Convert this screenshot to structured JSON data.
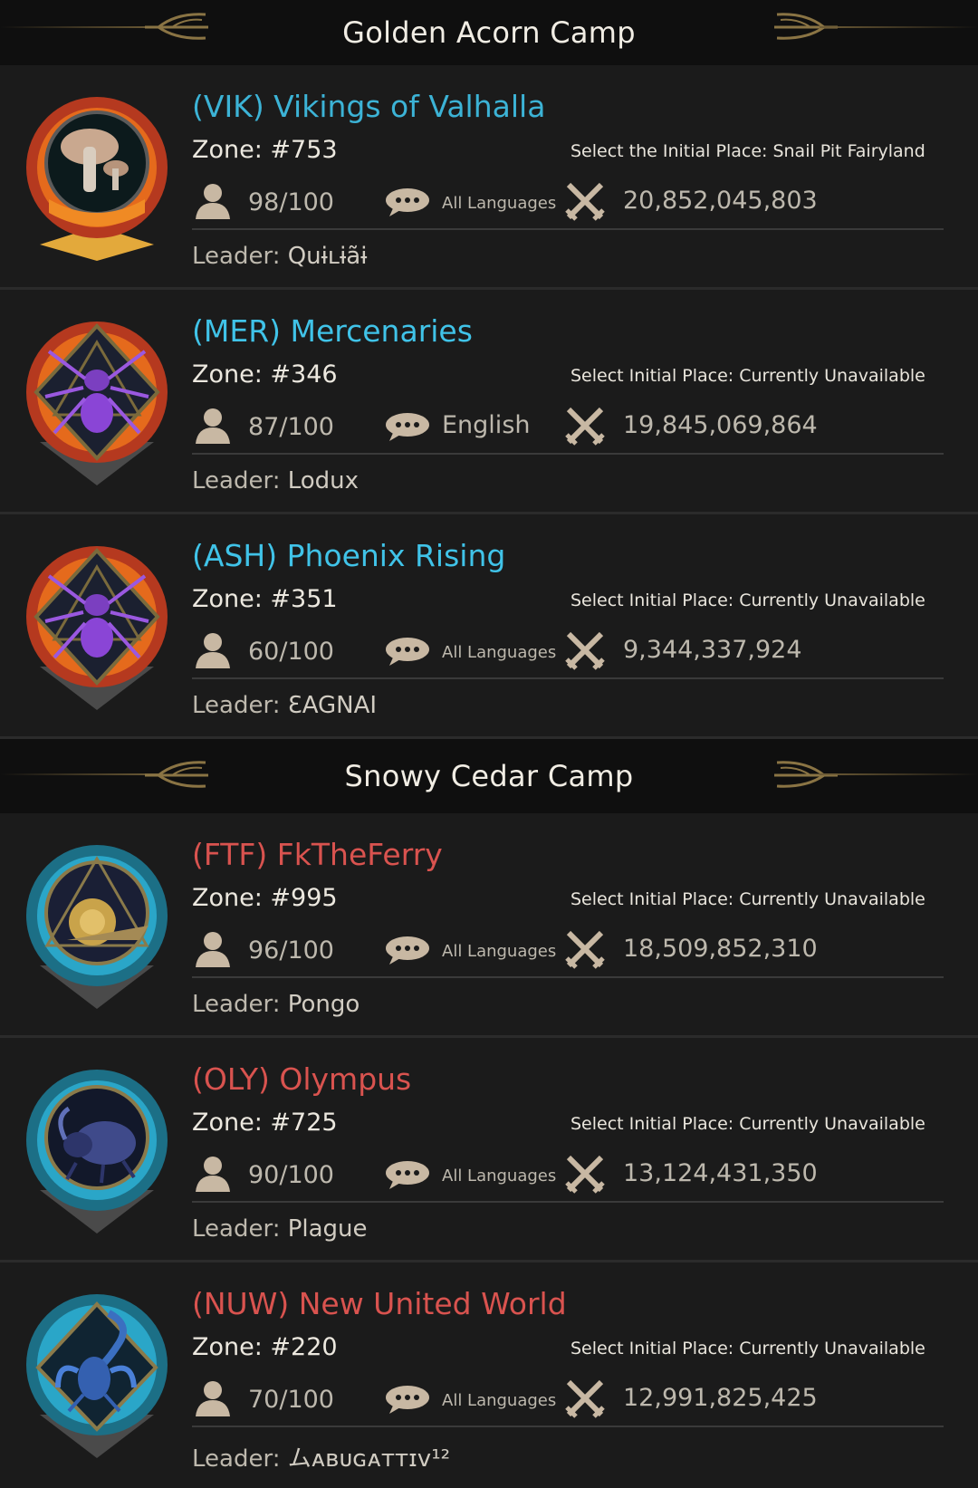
{
  "camps": [
    {
      "title": "Golden Acorn Camp",
      "alliances": [
        {
          "name": "(VIK) Vikings of Valhalla",
          "zone": "Zone: #753",
          "initial_place": "Select the Initial Place: Snail Pit Fairyland",
          "members": "98/100",
          "language": "All Languages",
          "power": "20,852,045,803",
          "leader_label": "Leader: ",
          "leader": "Quɨʟɨãɨ",
          "emblem_icon": "mushroom-emblem-icon"
        },
        {
          "name": "(MER) Mercenaries",
          "zone": "Zone: #346",
          "initial_place": "Select Initial Place: Currently Unavailable",
          "members": "87/100",
          "language": "English",
          "power": "19,845,069,864",
          "leader_label": "Leader: ",
          "leader": "Lodux",
          "emblem_icon": "spider-emblem-icon"
        },
        {
          "name": "(ASH) Phoenix Rising",
          "zone": "Zone: #351",
          "initial_place": "Select Initial Place: Currently Unavailable",
          "members": "60/100",
          "language": "All Languages",
          "power": "9,344,337,924",
          "leader_label": "Leader: ",
          "leader": "ƐAGNAI",
          "emblem_icon": "spider-emblem-icon"
        }
      ]
    },
    {
      "title": "Snowy Cedar Camp",
      "alliances": [
        {
          "name": "(FTF) FkTheFerry",
          "zone": "Zone: #995",
          "initial_place": "Select Initial Place: Currently Unavailable",
          "members": "96/100",
          "language": "All Languages",
          "power": "18,509,852,310",
          "leader_label": "Leader: ",
          "leader": "Pongo",
          "emblem_icon": "snail-emblem-icon"
        },
        {
          "name": "(OLY) Olympus",
          "zone": "Zone: #725",
          "initial_place": "Select Initial Place: Currently Unavailable",
          "members": "90/100",
          "language": "All Languages",
          "power": "13,124,431,350",
          "leader_label": "Leader: ",
          "leader": "Plague",
          "emblem_icon": "beetle-emblem-icon"
        },
        {
          "name": "(NUW) New United World",
          "zone": "Zone: #220",
          "initial_place": "Select Initial Place: Currently Unavailable",
          "members": "70/100",
          "language": "All Languages",
          "power": "12,991,825,425",
          "leader_label": "Leader: ",
          "leader": "ムᴀʙᴜɢᴀᴛᴛɪᴠ¹²",
          "emblem_icon": "scorpion-emblem-icon"
        }
      ]
    }
  ],
  "colors": {
    "golden_camp_name": "#3cb3d6",
    "snowy_camp_name": "#d9534f",
    "background": "#1a1a1a",
    "header_bg": "#0f0f0f"
  },
  "icons": {
    "member": "person-icon",
    "chat": "chat-bubble-icon",
    "power": "crossed-swords-icon",
    "header_ornament": "wing-ornament-icon"
  }
}
